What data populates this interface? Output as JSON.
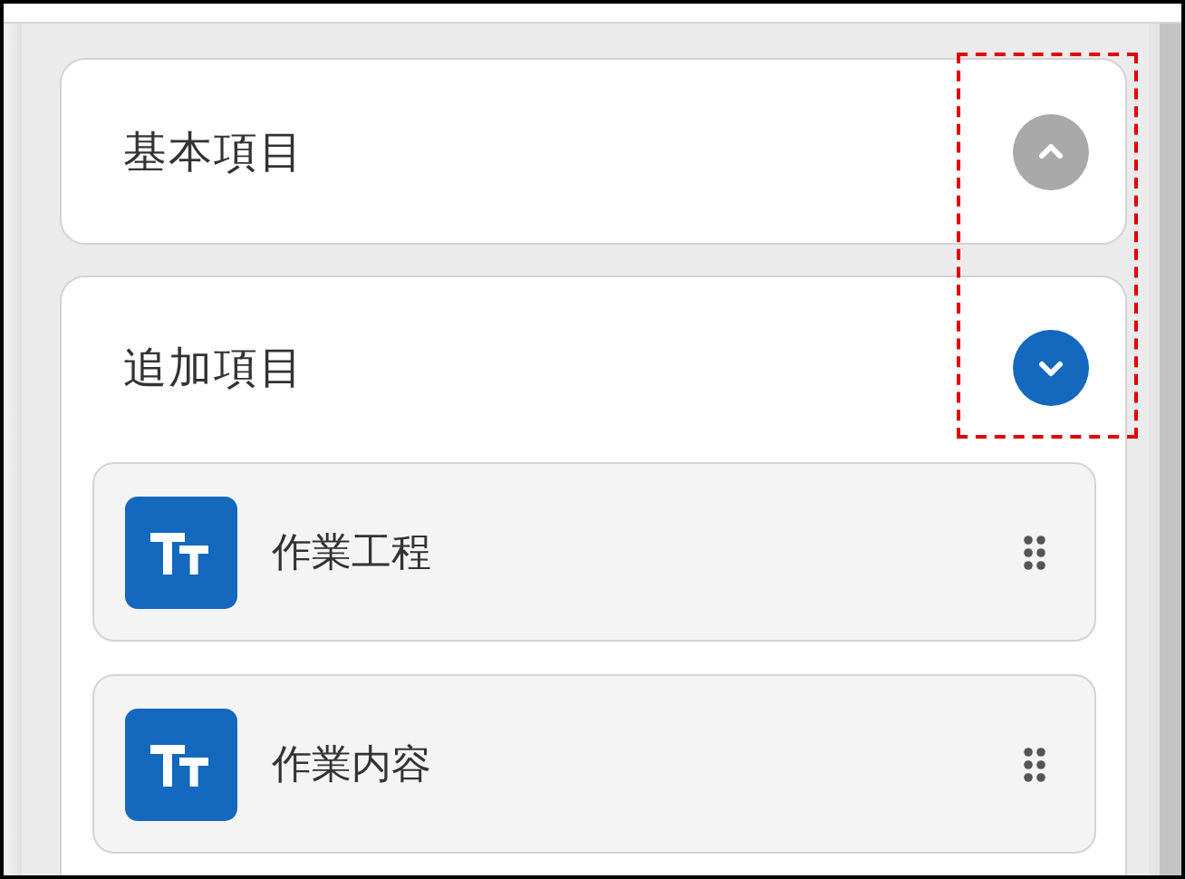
{
  "sections": [
    {
      "title": "基本項目",
      "expanded": false
    },
    {
      "title": "追加項目",
      "expanded": true,
      "items": [
        {
          "label": "作業工程"
        },
        {
          "label": "作業内容"
        }
      ]
    }
  ]
}
